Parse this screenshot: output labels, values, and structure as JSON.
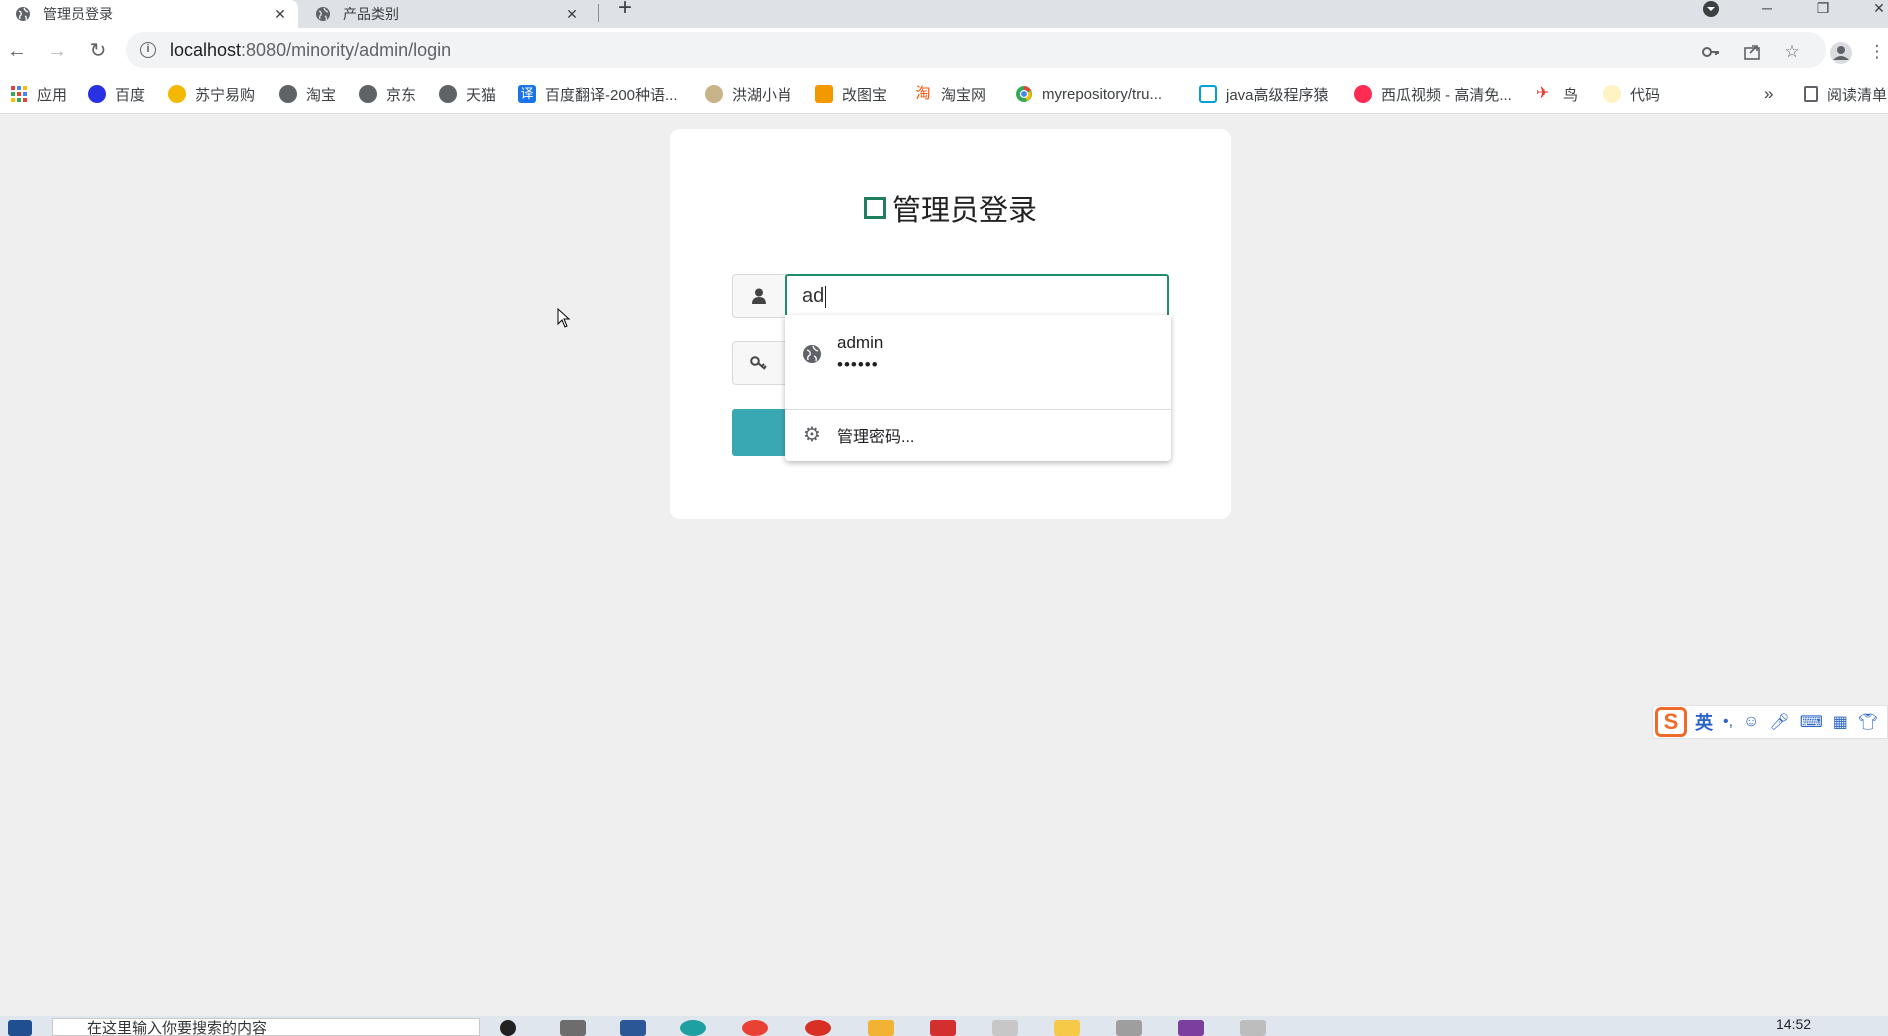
{
  "browser": {
    "tabs": [
      {
        "title": "管理员登录",
        "active": true
      },
      {
        "title": "产品类别",
        "active": false
      }
    ],
    "url_host": "localhost",
    "url_rest": ":8080/minority/admin/login"
  },
  "bookmarks": [
    {
      "label": "应用",
      "icon": "apps-grid-icon",
      "color": "#e94235"
    },
    {
      "label": "百度",
      "icon": "baidu-paw-icon",
      "color": "#2932e1"
    },
    {
      "label": "苏宁易购",
      "icon": "suning-icon",
      "color": "#f5b800"
    },
    {
      "label": "淘宝",
      "icon": "globe-icon",
      "color": "#5f6368"
    },
    {
      "label": "京东",
      "icon": "globe-icon",
      "color": "#5f6368"
    },
    {
      "label": "天猫",
      "icon": "globe-icon",
      "color": "#5f6368"
    },
    {
      "label": "百度翻译-200种语...",
      "icon": "translate-icon",
      "color": "#1a73e8"
    },
    {
      "label": "洪湖小肖",
      "icon": "bird-icon",
      "color": "#8a6d3b"
    },
    {
      "label": "改图宝",
      "icon": "gaitubao-icon",
      "color": "#f29900"
    },
    {
      "label": "淘宝网",
      "icon": "taobao-icon",
      "color": "#ff5000"
    },
    {
      "label": "myrepository/tru...",
      "icon": "chrome-icon",
      "color": "#34a853"
    },
    {
      "label": "java高级程序猿",
      "icon": "bilibili-icon",
      "color": "#00a1d6"
    },
    {
      "label": "西瓜视频 - 高清免...",
      "icon": "xigua-icon",
      "color": "#fe2c55"
    },
    {
      "label": "鸟",
      "icon": "bird-red-icon",
      "color": "#e53935"
    },
    {
      "label": "代码",
      "icon": "code-icon",
      "color": "#fbc02d"
    }
  ],
  "bookmarks_more": "»",
  "reading_list": "阅读清单",
  "page": {
    "title": "管理员登录",
    "username_value": "ad"
  },
  "autofill": {
    "username": "admin",
    "password_mask": "••••••",
    "manage_label": "管理密码..."
  },
  "ime": {
    "lang": "英"
  },
  "taskbar": {
    "search_placeholder": "在这里输入你要搜索的内容",
    "time": "14:52"
  }
}
